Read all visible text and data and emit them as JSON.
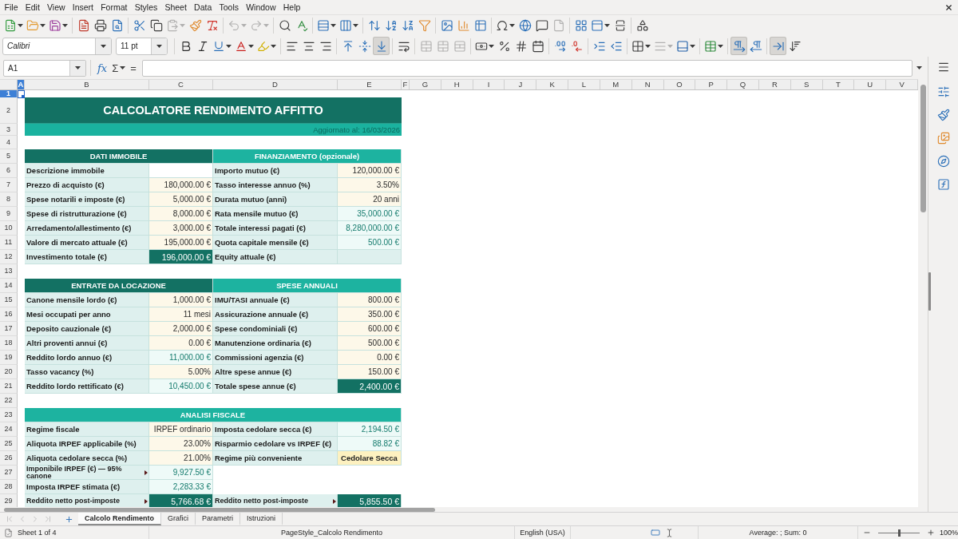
{
  "menu_bar": {
    "items": [
      "File",
      "Edit",
      "View",
      "Insert",
      "Format",
      "Styles",
      "Sheet",
      "Data",
      "Tools",
      "Window",
      "Help"
    ]
  },
  "standard_toolbar": [
    [
      {
        "kind": "new",
        "dropdown": true,
        "disabled": false
      },
      {
        "kind": "open",
        "dropdown": true,
        "disabled": false
      },
      {
        "kind": "save",
        "dropdown": true,
        "disabled": false
      }
    ],
    [
      {
        "kind": "export-pdf",
        "dropdown": false,
        "disabled": false
      },
      {
        "kind": "print",
        "dropdown": false,
        "disabled": false
      },
      {
        "kind": "print-preview",
        "dropdown": false,
        "disabled": false
      }
    ],
    [
      {
        "kind": "cut",
        "dropdown": false,
        "disabled": false
      },
      {
        "kind": "copy",
        "dropdown": false,
        "disabled": false
      },
      {
        "kind": "paste",
        "dropdown": true,
        "disabled": true
      },
      {
        "kind": "clone-formatting",
        "dropdown": false,
        "disabled": false
      },
      {
        "kind": "clear-formatting",
        "dropdown": false,
        "disabled": false
      }
    ],
    [
      {
        "kind": "undo",
        "dropdown": true,
        "disabled": true
      },
      {
        "kind": "redo",
        "dropdown": true,
        "disabled": true
      }
    ],
    [
      {
        "kind": "find-replace",
        "dropdown": false,
        "disabled": false
      },
      {
        "kind": "spelling",
        "dropdown": false,
        "disabled": false
      }
    ],
    [
      {
        "kind": "row",
        "dropdown": true,
        "disabled": false
      },
      {
        "kind": "column",
        "dropdown": true,
        "disabled": false
      }
    ],
    [
      {
        "kind": "sort",
        "dropdown": false,
        "disabled": false
      },
      {
        "kind": "sort-ascending",
        "dropdown": false,
        "disabled": false
      },
      {
        "kind": "sort-descending",
        "dropdown": false,
        "disabled": false
      },
      {
        "kind": "autofilter",
        "dropdown": false,
        "disabled": false
      }
    ],
    [
      {
        "kind": "image",
        "dropdown": false,
        "disabled": false
      },
      {
        "kind": "chart",
        "dropdown": false,
        "disabled": false
      },
      {
        "kind": "pivot-table",
        "dropdown": false,
        "disabled": false
      }
    ],
    [
      {
        "kind": "special-character",
        "dropdown": true,
        "disabled": false
      },
      {
        "kind": "hyperlink",
        "dropdown": false,
        "disabled": false
      },
      {
        "kind": "comment",
        "dropdown": false,
        "disabled": false
      },
      {
        "kind": "headers-footers",
        "dropdown": false,
        "disabled": true
      }
    ],
    [
      {
        "kind": "print-area",
        "dropdown": false,
        "disabled": false
      },
      {
        "kind": "freeze",
        "dropdown": true,
        "disabled": false
      },
      {
        "kind": "split-window",
        "dropdown": false,
        "disabled": false
      }
    ],
    [
      {
        "kind": "draw-functions",
        "dropdown": false,
        "disabled": false
      }
    ]
  ],
  "formatting_toolbar": {
    "font_name": "Calibri",
    "font_size": "11 pt",
    "groups": [
      [
        {
          "kind": "bold",
          "dropdown": false,
          "disabled": false,
          "pressed": false
        },
        {
          "kind": "italic",
          "dropdown": false,
          "disabled": false,
          "pressed": false
        },
        {
          "kind": "underline",
          "dropdown": true,
          "disabled": false,
          "pressed": false
        },
        {
          "kind": "font-color",
          "dropdown": true,
          "disabled": false,
          "pressed": false
        },
        {
          "kind": "highlighting",
          "dropdown": true,
          "disabled": false,
          "pressed": false
        }
      ],
      [
        {
          "kind": "align-left",
          "dropdown": false,
          "disabled": false,
          "pressed": false
        },
        {
          "kind": "align-center",
          "dropdown": false,
          "disabled": false,
          "pressed": false
        },
        {
          "kind": "align-right",
          "dropdown": false,
          "disabled": false,
          "pressed": false
        }
      ],
      [
        {
          "kind": "align-top",
          "dropdown": false,
          "disabled": false,
          "pressed": false
        },
        {
          "kind": "align-middle",
          "dropdown": false,
          "disabled": false,
          "pressed": false
        },
        {
          "kind": "align-bottom",
          "dropdown": false,
          "disabled": false,
          "pressed": true
        }
      ],
      [
        {
          "kind": "wrap-text",
          "dropdown": false,
          "disabled": false,
          "pressed": false
        }
      ],
      [
        {
          "kind": "merge-center",
          "dropdown": false,
          "disabled": true,
          "pressed": false
        },
        {
          "kind": "merge",
          "dropdown": false,
          "disabled": true,
          "pressed": false
        },
        {
          "kind": "unmerge",
          "dropdown": false,
          "disabled": true,
          "pressed": false
        }
      ],
      [
        {
          "kind": "currency",
          "dropdown": true,
          "disabled": false,
          "pressed": false
        },
        {
          "kind": "percent",
          "dropdown": false,
          "disabled": false,
          "pressed": false
        },
        {
          "kind": "number",
          "dropdown": false,
          "disabled": false,
          "pressed": false
        },
        {
          "kind": "date",
          "dropdown": false,
          "disabled": false,
          "pressed": false
        }
      ],
      [
        {
          "kind": "add-decimal",
          "dropdown": false,
          "disabled": false,
          "pressed": false
        },
        {
          "kind": "delete-decimal",
          "dropdown": false,
          "disabled": false,
          "pressed": false
        }
      ],
      [
        {
          "kind": "indent-increase",
          "dropdown": false,
          "disabled": false,
          "pressed": false
        },
        {
          "kind": "indent-decrease",
          "dropdown": false,
          "disabled": false,
          "pressed": false
        }
      ],
      [
        {
          "kind": "borders",
          "dropdown": true,
          "disabled": false,
          "pressed": false
        },
        {
          "kind": "border-style",
          "dropdown": true,
          "disabled": true,
          "pressed": false
        },
        {
          "kind": "border-color",
          "dropdown": true,
          "disabled": false,
          "pressed": false
        }
      ],
      [
        {
          "kind": "conditional",
          "dropdown": true,
          "disabled": false,
          "pressed": false
        }
      ],
      [
        {
          "kind": "left-to-right",
          "dropdown": false,
          "disabled": false,
          "pressed": true
        },
        {
          "kind": "right-to-left",
          "dropdown": false,
          "disabled": false,
          "pressed": false
        }
      ],
      [
        {
          "kind": "text-horizontal",
          "dropdown": false,
          "disabled": false,
          "pressed": true
        },
        {
          "kind": "text-vertical",
          "dropdown": false,
          "disabled": false,
          "pressed": false
        }
      ]
    ]
  },
  "formula_bar": {
    "name_box": "A1",
    "function_wizard": "fx",
    "sum": "Σ",
    "equals": "="
  },
  "sheet": {
    "columns": [
      {
        "label": "A",
        "selected": true
      },
      {
        "label": "B",
        "selected": false
      },
      {
        "label": "C",
        "selected": false
      },
      {
        "label": "D",
        "selected": false
      },
      {
        "label": "E",
        "selected": false
      },
      {
        "label": "F",
        "selected": false
      },
      {
        "label": "G",
        "selected": false
      },
      {
        "label": "H",
        "selected": false
      },
      {
        "label": "I",
        "selected": false
      },
      {
        "label": "J",
        "selected": false
      },
      {
        "label": "K",
        "selected": false
      },
      {
        "label": "L",
        "selected": false
      },
      {
        "label": "M",
        "selected": false
      },
      {
        "label": "N",
        "selected": false
      },
      {
        "label": "O",
        "selected": false
      },
      {
        "label": "P",
        "selected": false
      },
      {
        "label": "Q",
        "selected": false
      },
      {
        "label": "R",
        "selected": false
      },
      {
        "label": "S",
        "selected": false
      },
      {
        "label": "T",
        "selected": false
      },
      {
        "label": "U",
        "selected": false
      },
      {
        "label": "V",
        "selected": false
      }
    ],
    "rows": [
      {
        "number": "1",
        "selected": true
      },
      {
        "number": "2",
        "selected": false,
        "cells": [
          {
            "kind": "title",
            "text": "CALCOLATORE RENDIMENTO AFFITTO"
          }
        ]
      },
      {
        "number": "3",
        "selected": false,
        "cells": [
          {
            "kind": "subtitle",
            "text": "Aggiornato al: 16/03/2026"
          }
        ]
      },
      {
        "number": "4",
        "selected": false
      },
      {
        "number": "5",
        "selected": false,
        "cells": [
          {
            "kind": "dark-header",
            "text": "DATI IMMOBILE"
          },
          {
            "kind": "teal-header",
            "text": "FINANZIAMENTO (opzionale)"
          }
        ]
      },
      {
        "number": "6",
        "selected": false,
        "cells": [
          {
            "kind": "label",
            "text": "Descrizione immobile"
          },
          {
            "kind": "empty-input"
          },
          {
            "kind": "label",
            "text": "Importo mutuo (€)"
          },
          {
            "kind": "input",
            "text": "120,000.00 €"
          }
        ]
      },
      {
        "number": "7",
        "selected": false,
        "cells": [
          {
            "kind": "label",
            "text": "Prezzo di acquisto (€)"
          },
          {
            "kind": "input",
            "text": "180,000.00 €"
          },
          {
            "kind": "label",
            "text": "Tasso interesse annuo (%)"
          },
          {
            "kind": "input",
            "text": "3.50%"
          }
        ]
      },
      {
        "number": "8",
        "selected": false,
        "cells": [
          {
            "kind": "label",
            "text": "Spese notarili e imposte (€)"
          },
          {
            "kind": "input",
            "text": "5,000.00 €"
          },
          {
            "kind": "label",
            "text": "Durata mutuo (anni)"
          },
          {
            "kind": "input",
            "text": "20 anni"
          }
        ]
      },
      {
        "number": "9",
        "selected": false,
        "cells": [
          {
            "kind": "label",
            "text": "Spese di ristrutturazione (€)"
          },
          {
            "kind": "input",
            "text": "8,000.00 €"
          },
          {
            "kind": "label",
            "text": "Rata mensile mutuo (€)"
          },
          {
            "kind": "formula",
            "text": "35,000.00 €"
          }
        ]
      },
      {
        "number": "10",
        "selected": false,
        "cells": [
          {
            "kind": "label",
            "text": "Arredamento/allestimento (€)"
          },
          {
            "kind": "input",
            "text": "3,000.00 €"
          },
          {
            "kind": "label",
            "text": "Totale interessi pagati (€)"
          },
          {
            "kind": "formula",
            "text": "8,280,000.00 €"
          }
        ]
      },
      {
        "number": "11",
        "selected": false,
        "cells": [
          {
            "kind": "label",
            "text": "Valore di mercato attuale (€)"
          },
          {
            "kind": "input",
            "text": "195,000.00 €"
          },
          {
            "kind": "label",
            "text": "Quota capitale mensile (€)"
          },
          {
            "kind": "formula",
            "text": "500.00 €"
          }
        ]
      },
      {
        "number": "12",
        "selected": false,
        "cells": [
          {
            "kind": "label",
            "text": "Investimento totale (€)"
          },
          {
            "kind": "total",
            "text": "196,000.00 €"
          },
          {
            "kind": "label",
            "text": "Equity attuale (€)"
          },
          {
            "kind": "empty-label"
          }
        ]
      },
      {
        "number": "13",
        "selected": false
      },
      {
        "number": "14",
        "selected": false,
        "cells": [
          {
            "kind": "dark-header",
            "text": "ENTRATE DA LOCAZIONE"
          },
          {
            "kind": "teal-header",
            "text": "SPESE ANNUALI"
          }
        ]
      },
      {
        "number": "15",
        "selected": false,
        "cells": [
          {
            "kind": "label",
            "text": "Canone mensile lordo (€)"
          },
          {
            "kind": "input",
            "text": "1,000.00 €"
          },
          {
            "kind": "label",
            "text": "IMU/TASI annuale (€)"
          },
          {
            "kind": "input",
            "text": "800.00 €"
          }
        ]
      },
      {
        "number": "16",
        "selected": false,
        "cells": [
          {
            "kind": "label",
            "text": "Mesi occupati per anno"
          },
          {
            "kind": "input",
            "text": "11 mesi"
          },
          {
            "kind": "label",
            "text": "Assicurazione annuale (€)"
          },
          {
            "kind": "input",
            "text": "350.00 €"
          }
        ]
      },
      {
        "number": "17",
        "selected": false,
        "cells": [
          {
            "kind": "label",
            "text": "Deposito cauzionale (€)"
          },
          {
            "kind": "input",
            "text": "2,000.00 €"
          },
          {
            "kind": "label",
            "text": "Spese condominiali (€)"
          },
          {
            "kind": "input",
            "text": "600.00 €"
          }
        ]
      },
      {
        "number": "18",
        "selected": false,
        "cells": [
          {
            "kind": "label",
            "text": "Altri proventi annui (€)"
          },
          {
            "kind": "input",
            "text": "0.00 €"
          },
          {
            "kind": "label",
            "text": "Manutenzione ordinaria (€)"
          },
          {
            "kind": "input",
            "text": "500.00 €"
          }
        ]
      },
      {
        "number": "19",
        "selected": false,
        "cells": [
          {
            "kind": "label",
            "text": "Reddito lordo annuo (€)"
          },
          {
            "kind": "formula",
            "text": "11,000.00 €"
          },
          {
            "kind": "label",
            "text": "Commissioni agenzia (€)"
          },
          {
            "kind": "input",
            "text": "0.00 €"
          }
        ]
      },
      {
        "number": "20",
        "selected": false,
        "cells": [
          {
            "kind": "label",
            "text": "Tasso vacancy (%)"
          },
          {
            "kind": "input",
            "text": "5.00%"
          },
          {
            "kind": "label",
            "text": "Altre spese annue (€)"
          },
          {
            "kind": "input",
            "text": "150.00 €"
          }
        ]
      },
      {
        "number": "21",
        "selected": false,
        "cells": [
          {
            "kind": "label",
            "text": "Reddito lordo rettificato (€)"
          },
          {
            "kind": "formula",
            "text": "10,450.00 €"
          },
          {
            "kind": "label",
            "text": "Totale spese annue (€)"
          },
          {
            "kind": "total",
            "text": "2,400.00 €"
          }
        ]
      },
      {
        "number": "22",
        "selected": false
      },
      {
        "number": "23",
        "selected": false,
        "cells": [
          {
            "kind": "teal-header",
            "text": "ANALISI FISCALE"
          }
        ]
      },
      {
        "number": "24",
        "selected": false,
        "cells": [
          {
            "kind": "label",
            "text": "Regime fiscale"
          },
          {
            "kind": "input",
            "text": "IRPEF ordinario"
          },
          {
            "kind": "label",
            "text": "Imposta cedolare secca (€)"
          },
          {
            "kind": "formula",
            "text": "2,194.50 €"
          }
        ]
      },
      {
        "number": "25",
        "selected": false,
        "cells": [
          {
            "kind": "label",
            "text": "Aliquota IRPEF applicabile (%)"
          },
          {
            "kind": "input",
            "text": "23.00%"
          },
          {
            "kind": "label",
            "text": "Risparmio cedolare vs IRPEF (€)"
          },
          {
            "kind": "formula",
            "text": "88.82 €"
          }
        ]
      },
      {
        "number": "26",
        "selected": false,
        "cells": [
          {
            "kind": "label",
            "text": "Aliquota cedolare secca (%)"
          },
          {
            "kind": "input",
            "text": "21.00%"
          },
          {
            "kind": "label",
            "text": "Regime più conveniente"
          },
          {
            "kind": "choice",
            "text": "Cedolare Secca"
          }
        ]
      },
      {
        "number": "27",
        "selected": false,
        "cells": [
          {
            "kind": "long-label",
            "text": "Imponibile IRPEF (€) — 95% canone"
          },
          {
            "kind": "formula",
            "text": "9,927.50 €"
          },
          {
            "kind": "blank"
          },
          {
            "kind": "blank"
          }
        ]
      },
      {
        "number": "28",
        "selected": false,
        "cells": [
          {
            "kind": "label",
            "text": "Imposta IRPEF stimata (€)"
          },
          {
            "kind": "formula",
            "text": "2,283.33 €"
          },
          {
            "kind": "blank"
          },
          {
            "kind": "blank"
          }
        ]
      },
      {
        "number": "29",
        "selected": false,
        "cells": [
          {
            "kind": "long-label",
            "text": "Reddito netto post-imposte"
          },
          {
            "kind": "total",
            "text": "5,766.68 €"
          },
          {
            "kind": "long-label",
            "text": "Reddito netto post-imposte"
          },
          {
            "kind": "total",
            "text": "5,855.50 €"
          }
        ]
      }
    ]
  },
  "sheet_navigation": [
    {
      "kind": "first",
      "disabled": true
    },
    {
      "kind": "previous",
      "disabled": true
    },
    {
      "kind": "next",
      "disabled": true
    },
    {
      "kind": "last",
      "disabled": true
    }
  ],
  "sheet_tabs": [
    {
      "label": "Calcolo Rendimento",
      "selected": true
    },
    {
      "label": "Grafici",
      "selected": false
    },
    {
      "label": "Parametri",
      "selected": false
    },
    {
      "label": "Istruzioni",
      "selected": false
    }
  ],
  "status_bar": {
    "sheet_position": "Sheet 1 of 4",
    "page_style": "PageStyle_Calcolo Rendimento",
    "language": "English (USA)",
    "selection_summary": "Average: ; Sum: 0",
    "zoom": {
      "level": 0.5,
      "reading": "100%"
    }
  }
}
